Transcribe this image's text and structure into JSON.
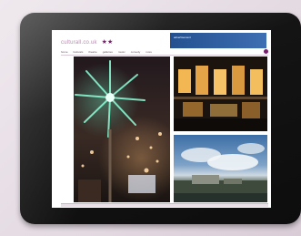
{
  "site": {
    "logo_text": "culturall.co.uk",
    "logo_stars": "★★"
  },
  "banner": {
    "text": "advertisement"
  },
  "nav": {
    "items": [
      "home",
      "festivals",
      "theatre",
      "galleries",
      "music",
      "comedy",
      "more"
    ]
  },
  "photos": [
    {
      "caption": ""
    },
    {
      "caption": ""
    },
    {
      "caption": ""
    }
  ]
}
